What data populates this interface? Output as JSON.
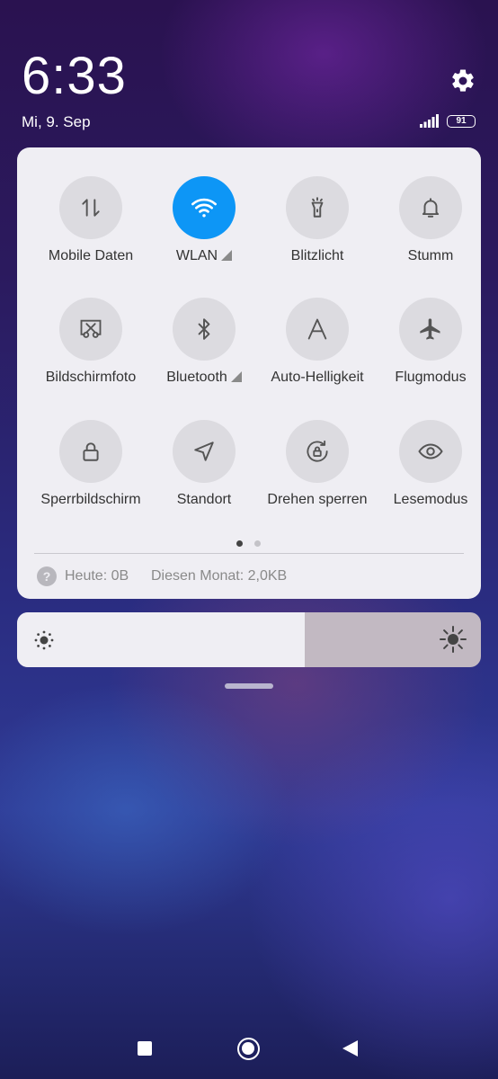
{
  "status": {
    "time": "6:33",
    "date": "Mi, 9. Sep",
    "battery": "91",
    "settings_icon": "gear-icon"
  },
  "tiles": [
    {
      "label": "Mobile Daten",
      "icon": "mobile-data-icon",
      "active": false
    },
    {
      "label": "WLAN",
      "icon": "wifi-icon",
      "active": true,
      "has_arrow": true
    },
    {
      "label": "Blitzlicht",
      "icon": "flashlight-icon",
      "active": false
    },
    {
      "label": "Stumm",
      "icon": "bell-icon",
      "active": false
    },
    {
      "label": "Bildschirmfoto",
      "icon": "screenshot-icon",
      "active": false
    },
    {
      "label": "Bluetooth",
      "icon": "bluetooth-icon",
      "active": false,
      "has_arrow": true
    },
    {
      "label": "Auto-Helligkeit",
      "icon": "auto-brightness-icon",
      "active": false
    },
    {
      "label": "Flugmodus",
      "icon": "airplane-icon",
      "active": false
    },
    {
      "label": "Sperrbildschirm",
      "icon": "lock-icon",
      "active": false
    },
    {
      "label": "Standort",
      "icon": "location-icon",
      "active": false
    },
    {
      "label": "Drehen sperren",
      "icon": "rotation-lock-icon",
      "active": false
    },
    {
      "label": "Lesemodus",
      "icon": "eye-icon",
      "active": false
    }
  ],
  "pager": {
    "pages": 2,
    "current": 1
  },
  "data_usage": {
    "today": "Heute: 0B",
    "month": "Diesen Monat: 2,0KB"
  },
  "brightness": {
    "level": 0.62
  },
  "colors": {
    "active_tile": "#0d96f6",
    "inactive_tile": "#dcdbe0",
    "panel": "#efeef3"
  }
}
